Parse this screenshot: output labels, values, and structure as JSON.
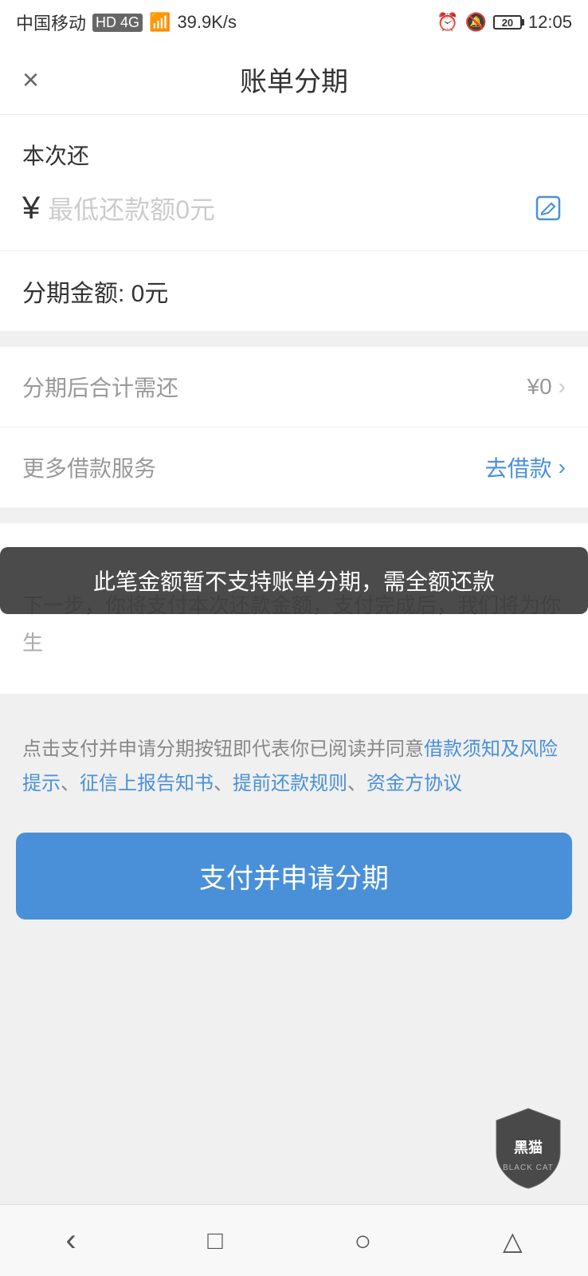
{
  "statusBar": {
    "carrier": "中国移动",
    "networkType": "HD 4G",
    "signal": "39.9K/s",
    "time": "12:05"
  },
  "header": {
    "close_label": "×",
    "title": "账单分期"
  },
  "paySection": {
    "label": "本次还",
    "yen_symbol": "¥",
    "placeholder": "最低还款额0元",
    "edit_icon": "✎"
  },
  "installmentSection": {
    "label": "分期金额: 0元"
  },
  "infoRows": [
    {
      "label": "分期后合计需还",
      "value": "¥0",
      "has_chevron": true
    },
    {
      "label": "更多借款服务",
      "value": "去借款",
      "has_chevron": true,
      "value_color": "blue"
    }
  ],
  "noticeText": "下一步，你将支付本次还款金额，支付完成后，我们将为你生",
  "toast": {
    "text": "此笔金额暂不支持账单分期，需全额还款"
  },
  "agreement": {
    "prefix": "点击支付并申请分期按钮即代表你已阅读并同意",
    "links": [
      "借款须知及风险提示",
      "征信上报告知书",
      "提前还款规则",
      "资金方协议"
    ]
  },
  "submitButton": {
    "label": "支付并申请分期"
  },
  "bottomNav": {
    "back": "‹",
    "square": "▢",
    "circle": "○",
    "triangle": "△"
  },
  "watermark": {
    "text": "黑猫",
    "subtext": "BLACK CAT"
  }
}
